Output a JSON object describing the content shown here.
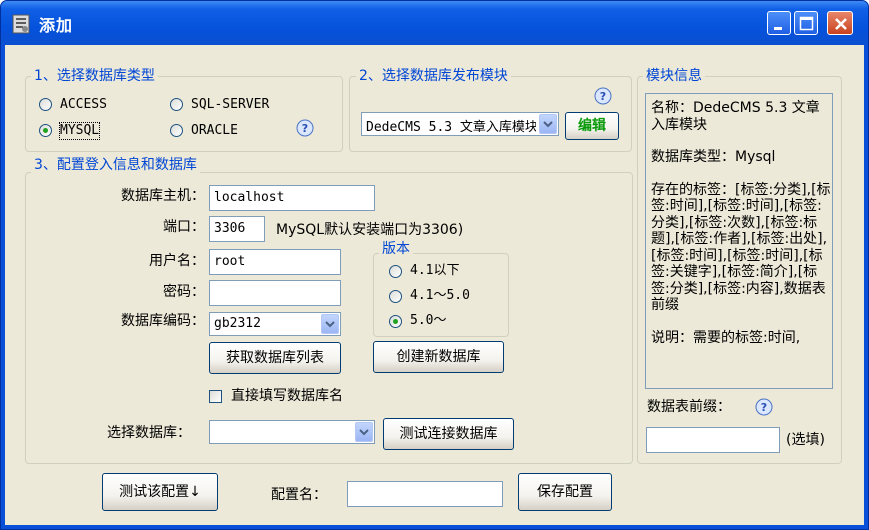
{
  "window": {
    "title": "添加"
  },
  "db_type": {
    "legend": "1、选择数据库类型",
    "options": [
      {
        "label": "ACCESS",
        "checked": false
      },
      {
        "label": "SQL-SERVER",
        "checked": false
      },
      {
        "label": "MYSQL",
        "checked": true
      },
      {
        "label": "ORACLE",
        "checked": false
      }
    ]
  },
  "module": {
    "legend": "2、选择数据库发布模块",
    "selected": "DedeCMS 5.3 文章入库模块",
    "edit_label": "编辑"
  },
  "config": {
    "legend": "3、配置登入信息和数据库",
    "host_label": "数据库主机：",
    "host_value": "localhost",
    "port_label": "端口：",
    "port_value": "3306",
    "port_hint": "MySQL默认安装端口为3306)",
    "user_label": "用户名：",
    "user_value": "root",
    "pass_label": "密码：",
    "pass_value": "",
    "enc_label": "数据库编码：",
    "enc_value": "gb2312",
    "version": {
      "legend": "版本",
      "options": [
        {
          "label": "4.1以下",
          "checked": false
        },
        {
          "label": "4.1～5.0",
          "checked": false
        },
        {
          "label": "5.0～",
          "checked": true
        }
      ]
    },
    "fetch_db_list": "获取数据库列表",
    "create_db": "创建新数据库",
    "direct_write": "直接填写数据库名",
    "select_db_label": "选择数据库：",
    "select_db_value": "",
    "test_conn": "测试连接数据库"
  },
  "info": {
    "legend": "模块信息",
    "name_line": "名称：DedeCMS 5.3 文章入库模块",
    "dbtype_line": "数据库类型：Mysql",
    "tags_line": "存在的标签：[标签:分类],[标签:时间],[标签:时间],[标签:分类],[标签:次数],[标签:标题],[标签:作者],[标签:出处],[标签:时间],[标签:时间],[标签:关键字],[标签:简介],[标签:分类],[标签:内容],数据表前缀",
    "note_line": "说明：需要的标签:时间,"
  },
  "prefix": {
    "label": "数据表前缀：",
    "value": "",
    "hint": "(选填)"
  },
  "bottom": {
    "test_config": "测试该配置↓",
    "config_name_label": "配置名：",
    "config_name_value": "",
    "save": "保存配置"
  },
  "colors": {
    "title_bar": "#0552dc",
    "client": "#ece9d8",
    "group_label": "#0046d5",
    "edit_button_text": "#0a9a0a"
  }
}
